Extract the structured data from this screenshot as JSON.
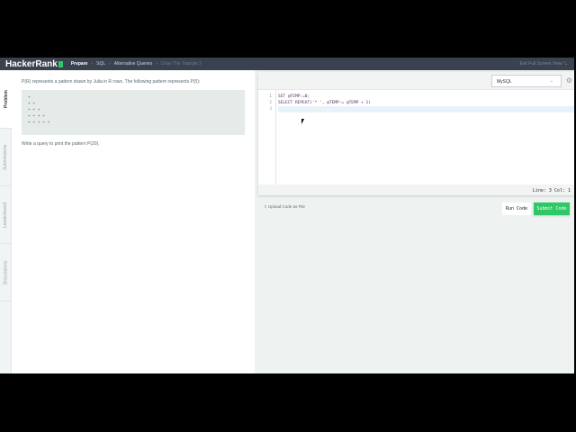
{
  "header": {
    "logo": "HackerRank",
    "breadcrumb": [
      "Prepare",
      "SQL",
      "Alternative Queries",
      "Draw The Triangle 2"
    ],
    "exit": "Exit Full Screen View"
  },
  "tabs": [
    "Problem",
    "Submissions",
    "Leaderboard",
    "Discussions"
  ],
  "problem": {
    "intro": "P(R) represents a pattern drawn by Julia in R rows. The following pattern represents P(5):",
    "pattern": "*\n* *\n* * *\n* * * *\n* * * * *",
    "task": "Write a query to print the pattern P(20)."
  },
  "editor": {
    "language": "MySQL",
    "lines": [
      "SET @TEMP:=0;",
      "SELECT REPEAT('* ', @TEMP:= @TEMP + 1)",
      ""
    ],
    "line_numbers": [
      "1",
      "2",
      "3"
    ],
    "status": "Line: 3 Col: 1"
  },
  "actions": {
    "upload": "Upload Code as File",
    "run": "Run Code",
    "submit": "Submit Code"
  },
  "colors": {
    "header": "#39424e",
    "accent": "#2ec866"
  }
}
